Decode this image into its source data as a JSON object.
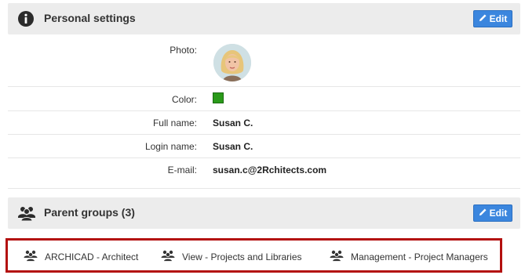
{
  "personal": {
    "title": "Personal settings",
    "edit_label": "Edit",
    "photo_label": "Photo:",
    "color_label": "Color:",
    "color_value": "#2a9a1a",
    "fullname_label": "Full name:",
    "fullname_value": "Susan C.",
    "login_label": "Login name:",
    "login_value": "Susan C.",
    "email_label": "E-mail:",
    "email_value": "susan.c@2Rchitects.com"
  },
  "parent": {
    "title": "Parent groups (3)",
    "edit_label": "Edit",
    "groups": [
      {
        "label": "ARCHICAD - Architect",
        "icon": "group-icon"
      },
      {
        "label": "View - Projects and Libraries",
        "icon": "group-icon"
      },
      {
        "label": "Management - Project Managers",
        "icon": "group-icon"
      }
    ]
  },
  "colors": {
    "header_bg": "#ececec",
    "edit_button": "#3b86de",
    "highlight_border": "#b3100f"
  }
}
